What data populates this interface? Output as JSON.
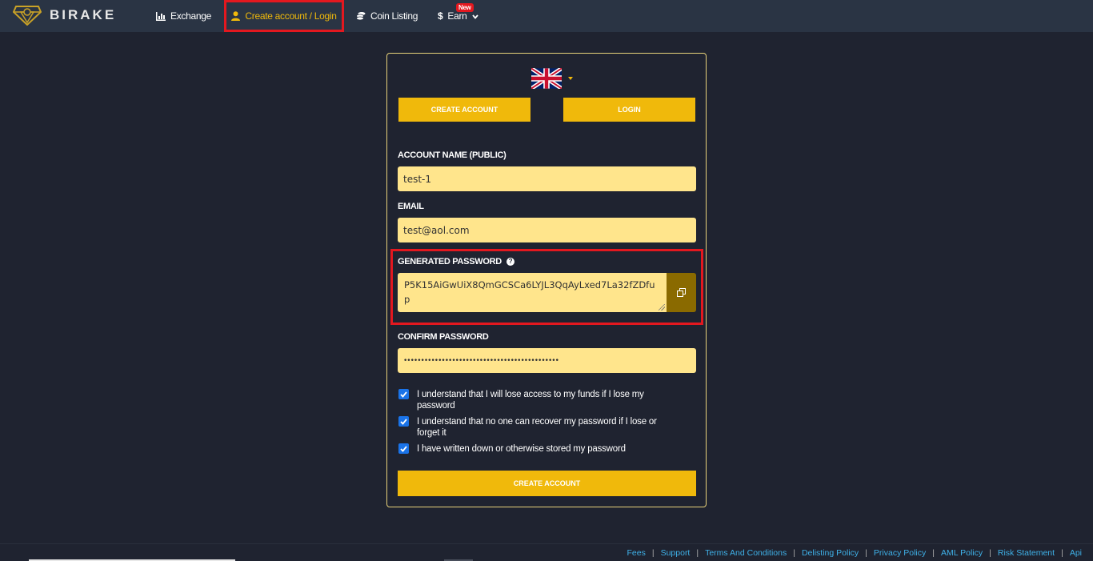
{
  "header": {
    "logo_text": "BIRAKE",
    "nav": {
      "exchange": "Exchange",
      "create_login": "Create account / Login",
      "coin_listing": "Coin Listing",
      "earn": "Earn",
      "earn_badge": "New"
    }
  },
  "card": {
    "language": "en-GB",
    "tabs": {
      "create": "CREATE ACCOUNT",
      "login": "LOGIN"
    },
    "account_name": {
      "label": "ACCOUNT NAME (PUBLIC)",
      "value": "test-1"
    },
    "email": {
      "label": "EMAIL",
      "value": "test@aol.com"
    },
    "generated_password": {
      "label": "GENERATED PASSWORD",
      "value": "P5K15AiGwUiX8QmGCSCa6LYJL3QqAyLxed7La32fZDfup"
    },
    "confirm_password": {
      "label": "CONFIRM PASSWORD",
      "value": "•••••••••••••••••••••••••••••••••••••••••••••"
    },
    "checkboxes": [
      {
        "label": "I understand that I will lose access to my funds if I lose my password",
        "checked": true
      },
      {
        "label": "I understand that no one can recover my password if I lose or forget it",
        "checked": true
      },
      {
        "label": "I have written down or otherwise stored my password",
        "checked": true
      }
    ],
    "submit": "CREATE ACCOUNT"
  },
  "footer": {
    "links": [
      "Fees",
      "Support",
      "Terms And Conditions",
      "Delisting Policy",
      "Privacy Policy",
      "AML Policy",
      "Risk Statement",
      "Api"
    ]
  },
  "colors": {
    "accent": "#f0b90b",
    "field_bg": "#ffe58c",
    "highlight": "#e3181f",
    "link": "#3fb1e8",
    "background": "#1f2330"
  }
}
